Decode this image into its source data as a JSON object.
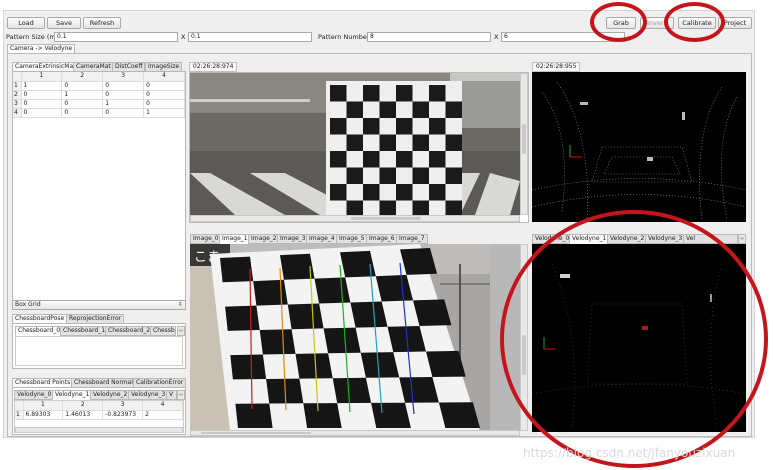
{
  "toolbar": {
    "load_label": "Load",
    "save_label": "Save",
    "refresh_label": "Refresh",
    "grab_label": "Grab",
    "hidden_label": "Invers",
    "calibrate_label": "Calibrate",
    "project_label": "Project"
  },
  "pattern": {
    "size_label": "Pattern Size (m)",
    "size_w": "0.1",
    "size_x_label": "X",
    "size_h": "0.1",
    "number_label": "Pattern Number",
    "number_w": "8",
    "number_x_label": "X",
    "number_h": "6"
  },
  "main_tab": "Camera -> Velodyne",
  "param_tabs": [
    "CameraExtrinsicMat",
    "CameraMat",
    "DistCoeff",
    "ImageSize"
  ],
  "matrix": {
    "headers": [
      "1",
      "2",
      "3",
      "4"
    ],
    "rows": [
      {
        "h": "1",
        "cells": [
          "1",
          "0",
          "0",
          "0"
        ]
      },
      {
        "h": "2",
        "cells": [
          "0",
          "1",
          "0",
          "0"
        ]
      },
      {
        "h": "3",
        "cells": [
          "0",
          "0",
          "1",
          "0"
        ]
      },
      {
        "h": "4",
        "cells": [
          "0",
          "0",
          "0",
          "1"
        ]
      }
    ]
  },
  "box_grid": "Box Grid",
  "pose_tabs": [
    "ChessboardPose",
    "ReprojectionError"
  ],
  "pose_subtabs": [
    "Chessboard_0",
    "Chessboard_1",
    "Chessboard_2",
    "Chessbo"
  ],
  "points_tabs": [
    "Chessboard Points",
    "Chessboard Normals",
    "CalibrationError"
  ],
  "points_subtabs": [
    "Velodyne_0",
    "Velodyne_1",
    "Velodyne_2",
    "Velodyne_3",
    "V"
  ],
  "points_table": {
    "headers": [
      "1",
      "2",
      "3",
      "4"
    ],
    "rows": [
      {
        "h": "1",
        "cells": [
          "6.89303",
          "1.46013",
          "-0.823973",
          "2"
        ]
      }
    ]
  },
  "timestamps": {
    "camera": "02:26:28:974",
    "velodyne": "02:26:28:955"
  },
  "image_tabs": [
    "Image_0",
    "Image_1",
    "Image_2",
    "Image_3",
    "Image_4",
    "Image_5",
    "Image_6",
    "Image_7"
  ],
  "image_tab_selected": 1,
  "velodyne_tabs": [
    "Velodyne_0",
    "Velodyne_1",
    "Velodyne_2",
    "Velodyne_3",
    "Vel"
  ],
  "velodyne_tab_selected": 1,
  "jp_sign_text": "こま",
  "watermark": "https://blog.csdn.net/jfanyouzixuan",
  "colors": {
    "highlight_ring": "#c4151c",
    "window_bg": "#efefef"
  }
}
